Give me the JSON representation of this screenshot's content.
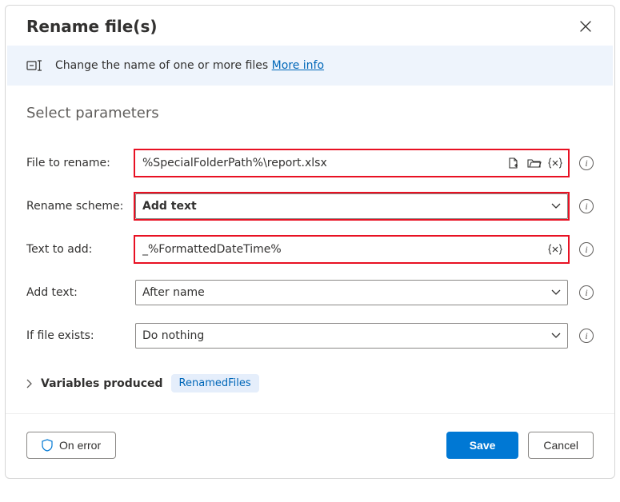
{
  "header": {
    "title": "Rename file(s)"
  },
  "banner": {
    "text": "Change the name of one or more files",
    "more_info": "More info"
  },
  "section_title": "Select parameters",
  "fields": {
    "file_to_rename": {
      "label": "File to rename:",
      "value": "%SpecialFolderPath%\\report.xlsx"
    },
    "rename_scheme": {
      "label": "Rename scheme:",
      "value": "Add text"
    },
    "text_to_add": {
      "label": "Text to add:",
      "value": "_%FormattedDateTime%"
    },
    "add_text": {
      "label": "Add text:",
      "value": "After name"
    },
    "if_file_exists": {
      "label": "If file exists:",
      "value": "Do nothing"
    }
  },
  "variables": {
    "chevron_label": "Variables produced",
    "label": "Variables produced",
    "badge": "RenamedFiles"
  },
  "footer": {
    "on_error": "On error",
    "save": "Save",
    "cancel": "Cancel"
  }
}
